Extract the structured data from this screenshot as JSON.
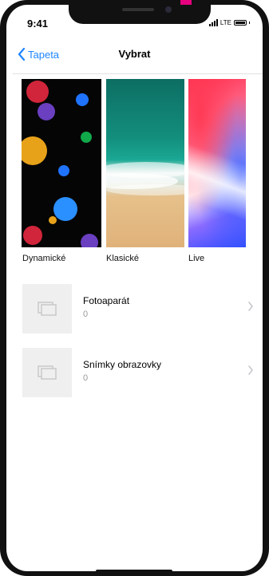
{
  "status_bar": {
    "time": "9:41",
    "network": "LTE"
  },
  "nav": {
    "back_label": "Tapeta",
    "title": "Vybrat"
  },
  "categories": [
    {
      "label": "Dynamické"
    },
    {
      "label": "Klasické"
    },
    {
      "label": "Live"
    }
  ],
  "albums": [
    {
      "name": "Fotoaparát",
      "count": "0"
    },
    {
      "name": "Snímky obrazovky",
      "count": "0"
    }
  ],
  "colors": {
    "accent": "#1f86ff",
    "brand_tab": "#e6007e"
  },
  "icons": {
    "back": "chevron-left-icon",
    "album_placeholder": "photo-stack-icon",
    "row_disclosure": "chevron-right-icon"
  }
}
